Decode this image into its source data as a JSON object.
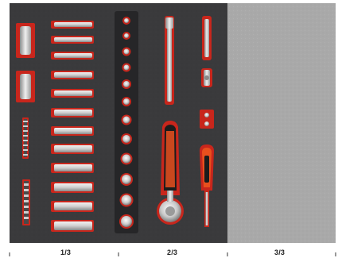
{
  "image": {
    "subject": "tool-tray-foam-insert",
    "colors": {
      "foam": "#3a3a3c",
      "foam_dark": "#262628",
      "cutout_red": "#c8261c",
      "metal": "#d7d7d7",
      "metal_shadow": "#8d8d8d",
      "handle_orange": "#e8501e",
      "empty_panel": "#a9a9a9"
    },
    "icons": [
      "socket-icon",
      "ratchet-icon",
      "screwdriver-icon",
      "extension-bar-icon"
    ]
  },
  "scale": {
    "labels": [
      "1/3",
      "2/3",
      "3/3"
    ]
  }
}
